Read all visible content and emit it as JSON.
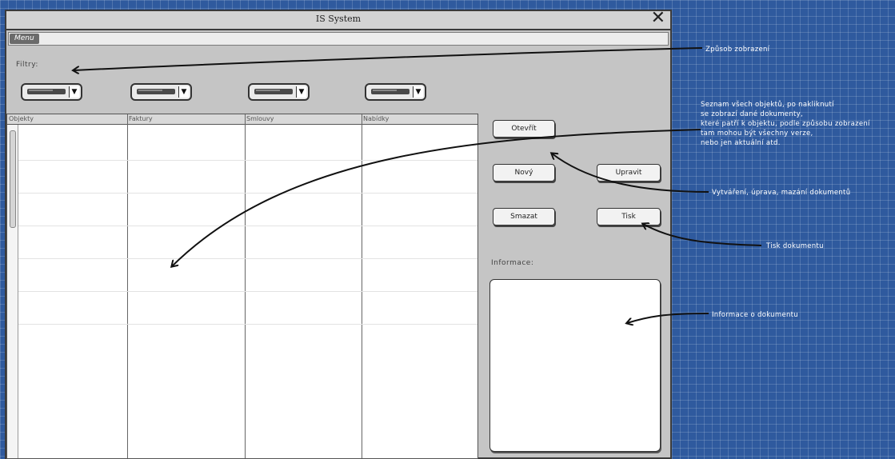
{
  "window": {
    "title": "IS System",
    "close_glyph": "✕"
  },
  "menu": {
    "label": "Menu"
  },
  "filters": {
    "label": "Filtry:",
    "dropdown_arrow": "▼"
  },
  "table": {
    "columns": [
      "Objekty",
      "Faktury",
      "Smlouvy",
      "Nabídky"
    ]
  },
  "buttons": {
    "open": "Otevřít",
    "new": "Nový",
    "edit": "Upravit",
    "delete": "Smazat",
    "print": "Tisk"
  },
  "info": {
    "label": "Informace:"
  },
  "annotations": {
    "view_mode": "Způsob zobrazení",
    "object_list": [
      "Seznam všech objektů, po nakliknutí",
      " se zobrazí dané dokumenty,",
      "které patří k objektu, podle způsobu zobrazení",
      " tam mohou být všechny verze,",
      "nebo jen aktuální atd."
    ],
    "crud": "Vytváření, úprava, mazání dokumentů",
    "print_doc": "Tisk dokumentu",
    "doc_info": "Informace o dokumentu"
  }
}
